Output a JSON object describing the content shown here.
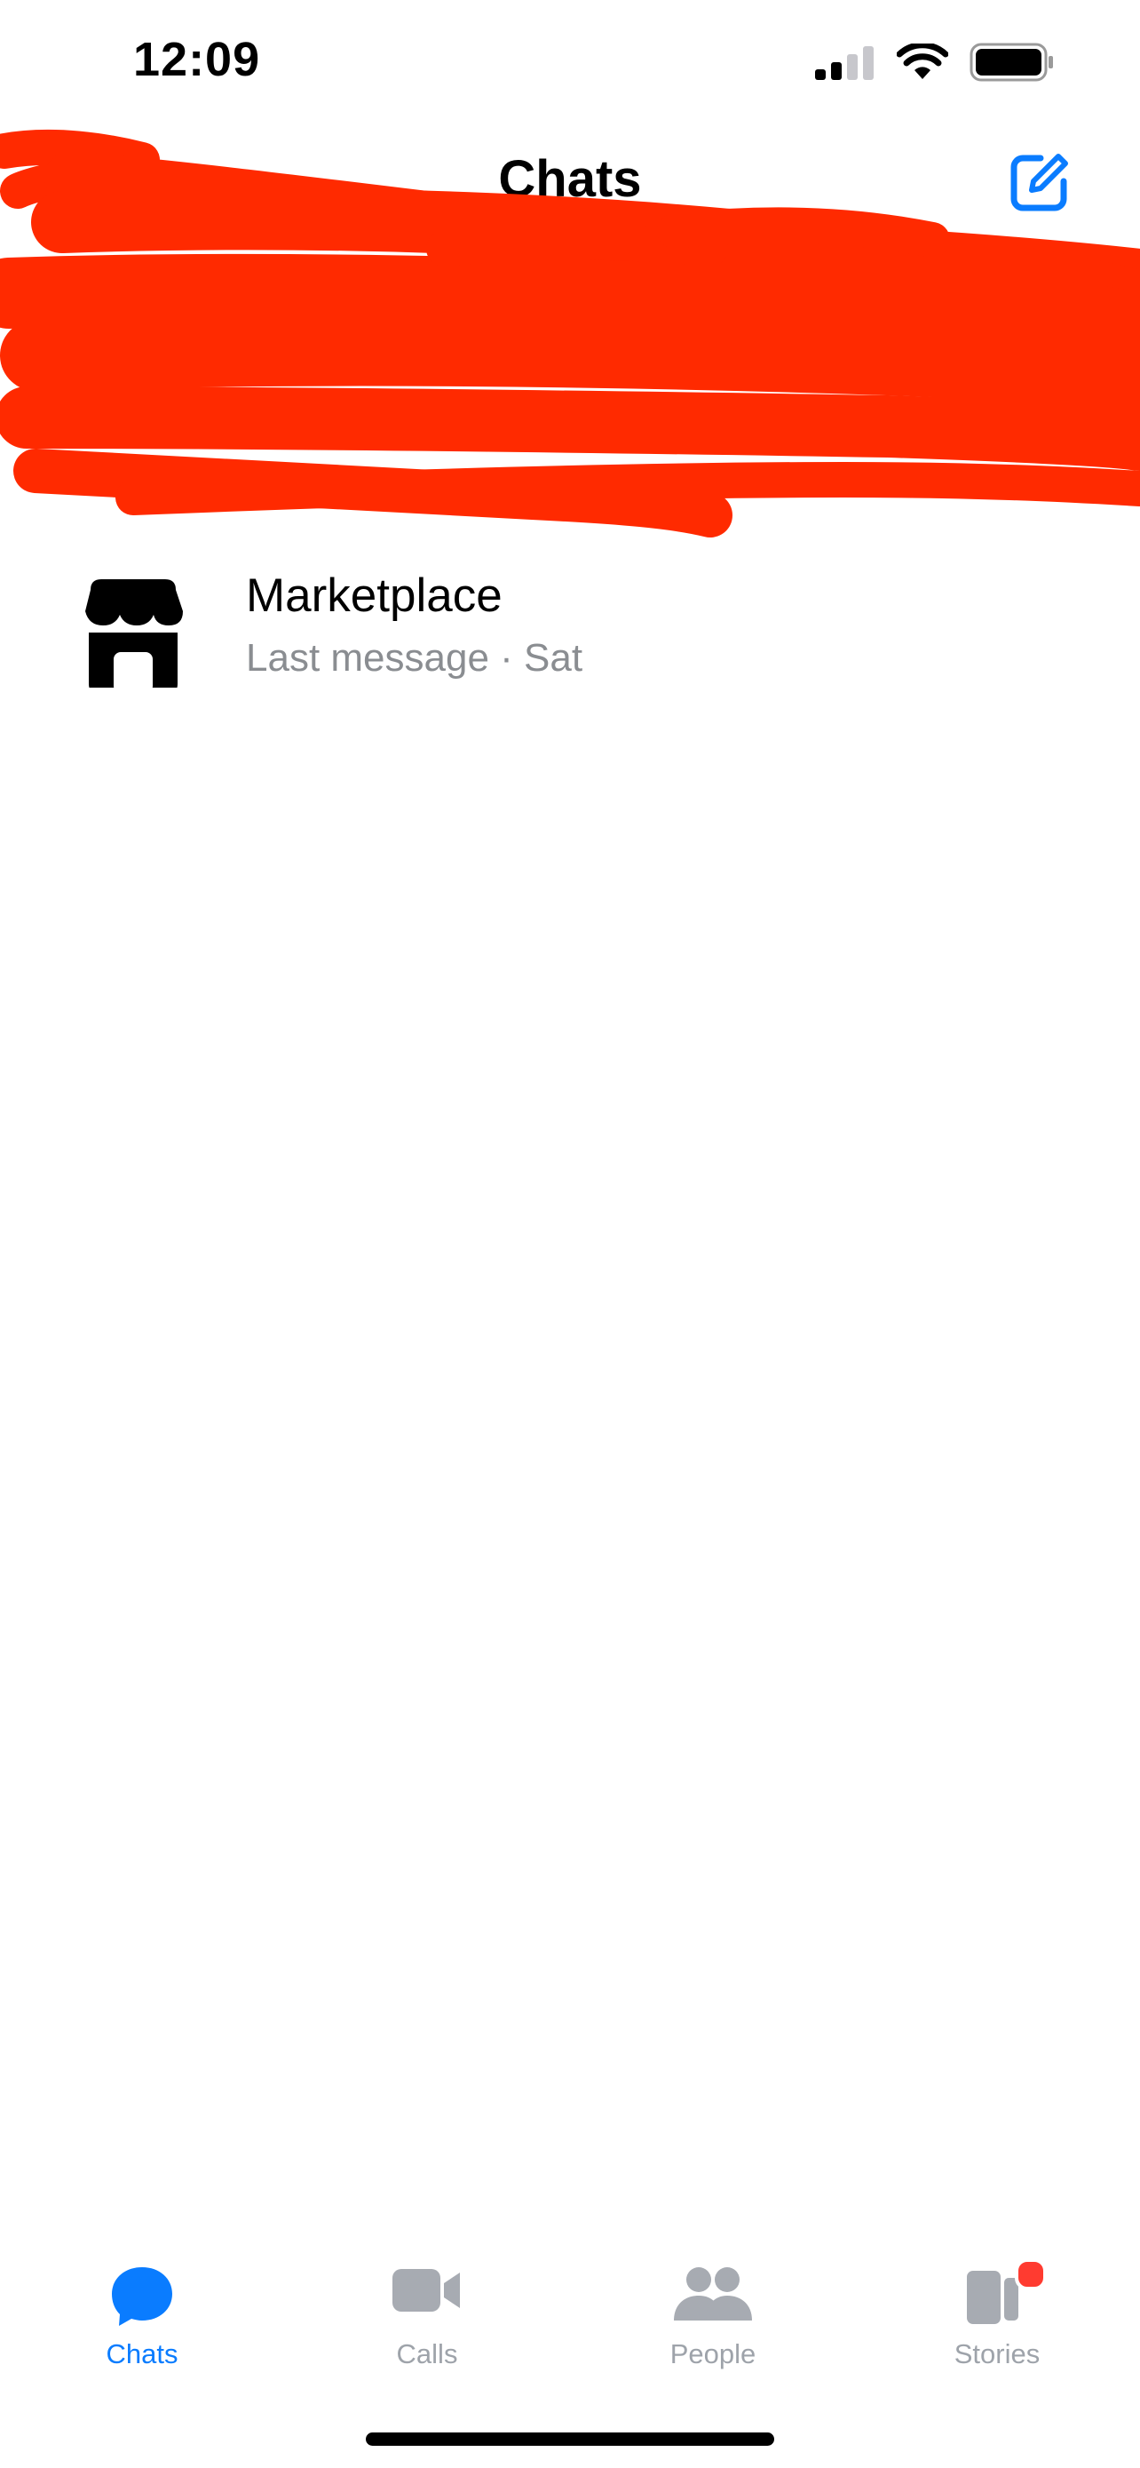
{
  "status_bar": {
    "time": "12:09",
    "icons": [
      "cellular-signal-icon",
      "wifi-icon",
      "battery-icon"
    ]
  },
  "header": {
    "title": "Chats",
    "compose_icon": "compose-icon"
  },
  "chats": [
    {
      "name": "Marketplace",
      "preview": "Last message · Sat",
      "icon": "storefront-icon"
    }
  ],
  "tab_bar": {
    "tabs": [
      {
        "label": "Chats",
        "icon": "chat-bubble-icon",
        "active": true
      },
      {
        "label": "Calls",
        "icon": "video-camera-icon",
        "active": false
      },
      {
        "label": "People",
        "icon": "people-icon",
        "active": false
      },
      {
        "label": "Stories",
        "icon": "stories-icon",
        "active": false,
        "badge": true
      }
    ]
  },
  "colors": {
    "accent": "#0a7cff",
    "inactive": "#9ea3aa",
    "preview_text": "#8a8d91",
    "redaction": "#ff2a00",
    "badge": "#ff3b30"
  }
}
